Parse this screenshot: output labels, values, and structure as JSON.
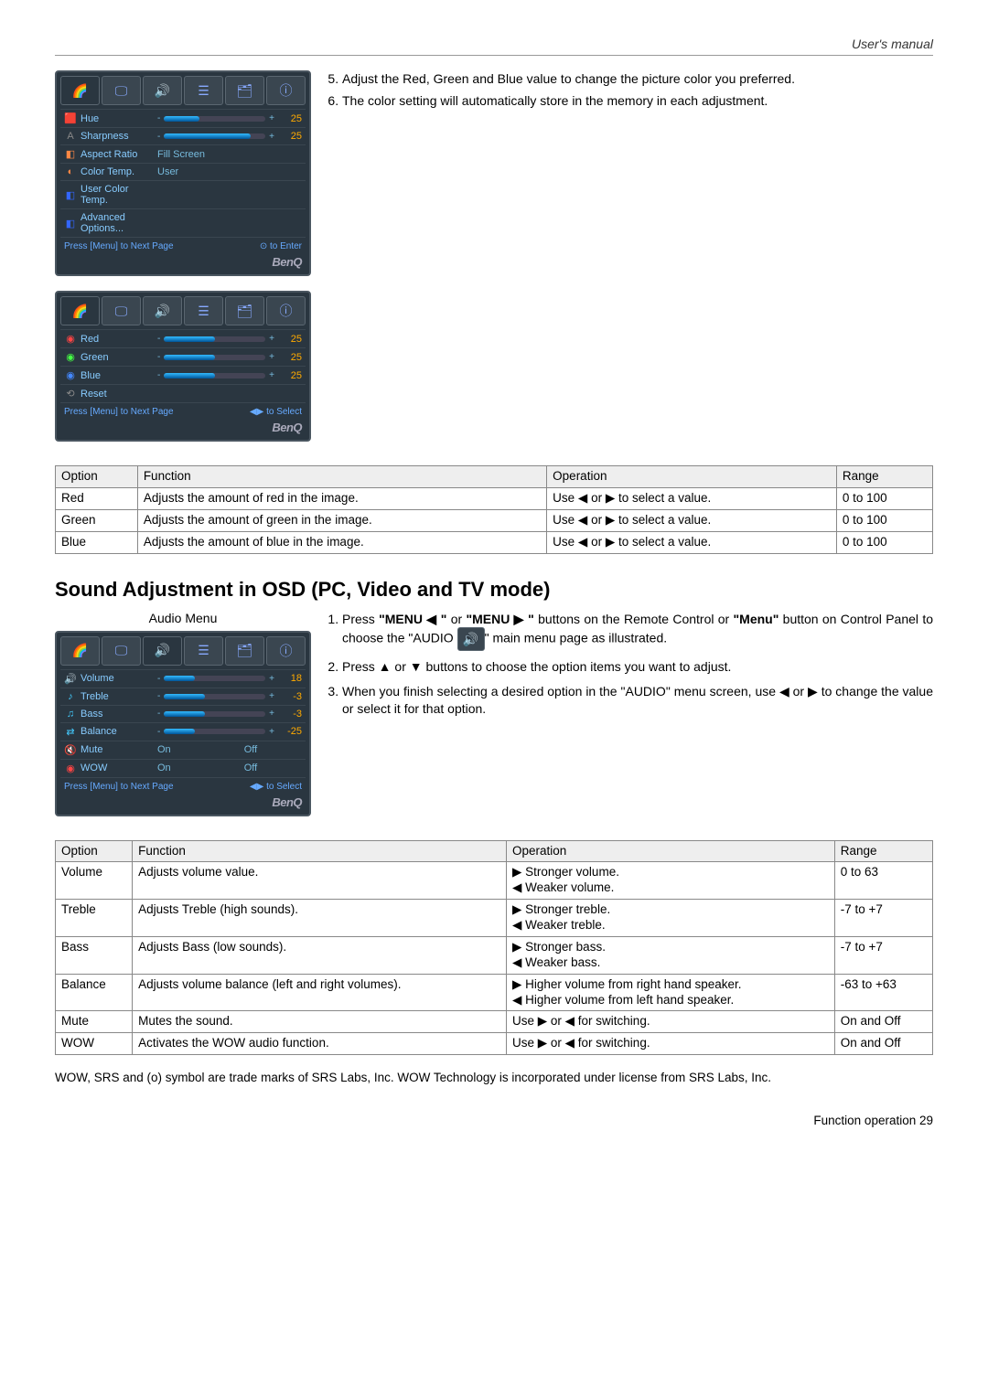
{
  "header": {
    "title": "User's manual"
  },
  "osd1": {
    "rows": [
      {
        "icon": "🟥",
        "label": "Hue",
        "num": "25",
        "fill": "35%",
        "color": "#f44"
      },
      {
        "icon": "A",
        "label": "Sharpness",
        "num": "25",
        "fill": "85%",
        "color": "#888"
      },
      {
        "icon": "◧",
        "label": "Aspect Ratio",
        "val": "Fill Screen",
        "color": "#f84"
      },
      {
        "icon": "◐",
        "label": "Color Temp.",
        "val": "User",
        "color": "#f84"
      },
      {
        "icon": "◧",
        "label": "User Color Temp.",
        "color": "#36f"
      },
      {
        "icon": "◧",
        "label": "Advanced Options...",
        "color": "#36f"
      }
    ],
    "footLeft": "Press [Menu] to Next Page",
    "footRight": "⊙ to Enter",
    "brand": "BenQ"
  },
  "osd2": {
    "rows": [
      {
        "icon": "◉",
        "label": "Red",
        "num": "25",
        "fill": "50%",
        "color": "#f44"
      },
      {
        "icon": "◉",
        "label": "Green",
        "num": "25",
        "fill": "50%",
        "color": "#4f4"
      },
      {
        "icon": "◉",
        "label": "Blue",
        "num": "25",
        "fill": "50%",
        "color": "#48f"
      },
      {
        "icon": "⟲",
        "label": "Reset",
        "color": "#888"
      }
    ],
    "footLeft": "Press [Menu] to Next Page",
    "footRight": "◀▶ to Select",
    "brand": "BenQ"
  },
  "topNotes": [
    {
      "num": "5.",
      "text": "Adjust the Red, Green and Blue value to change the picture color you preferred."
    },
    {
      "num": "6.",
      "text": "The color setting will automatically store in the memory in each adjustment."
    }
  ],
  "table1": {
    "headers": [
      "Option",
      "Function",
      "Operation",
      "Range"
    ],
    "rows": [
      [
        "Red",
        "Adjusts the amount of red in the image.",
        "Use ◀ or ▶ to select a value.",
        "0 to 100"
      ],
      [
        "Green",
        "Adjusts the amount of green in the image.",
        "Use ◀ or ▶ to select a value.",
        "0 to 100"
      ],
      [
        "Blue",
        "Adjusts the amount of blue in the image.",
        "Use ◀ or ▶ to select a value.",
        "0 to 100"
      ]
    ]
  },
  "soundHeading": "Sound Adjustment in OSD (PC, Video and TV mode)",
  "audioCaption": "Audio Menu",
  "osd3": {
    "rows": [
      {
        "icon": "🔊",
        "label": "Volume",
        "num": "18",
        "fill": "30%",
        "color": "#4cf"
      },
      {
        "icon": "♪",
        "label": "Treble",
        "num": "-3",
        "fill": "40%",
        "color": "#4cf"
      },
      {
        "icon": "♫",
        "label": "Bass",
        "num": "-3",
        "fill": "40%",
        "color": "#4cf"
      },
      {
        "icon": "⇄",
        "label": "Balance",
        "num": "-25",
        "fill": "30%",
        "color": "#4cf"
      },
      {
        "icon": "🔇",
        "label": "Mute",
        "val": "On",
        "val2": "Off",
        "color": "#f44"
      },
      {
        "icon": "◉",
        "label": "WOW",
        "val": "On",
        "val2": "Off",
        "color": "#f44"
      }
    ],
    "footLeft": "Press [Menu] to Next Page",
    "footRight": "◀▶ to Select",
    "brand": "BenQ"
  },
  "audioNotes": {
    "note1a": "Press ",
    "menuL": "\"MENU ◀ \"",
    "note1b": " or ",
    "menuR": "\"MENU ▶ \"",
    "note1c": " buttons on the Remote Control or ",
    "menuBold": "\"Menu\"",
    "note1d": " button on Control Panel to choose the \"AUDIO ",
    "note1e": "\" main menu page as illustrated.",
    "note2": "Press ▲ or ▼ buttons to choose the option items you want to adjust.",
    "note3": "When you finish selecting a desired option in the \"AUDIO\" menu screen, use ◀ or ▶ to change the value or select it for that option."
  },
  "table2": {
    "headers": [
      "Option",
      "Function",
      "Operation",
      "Range"
    ],
    "rows": [
      [
        "Volume",
        "Adjusts volume value.",
        "▶ Stronger volume.\n◀ Weaker volume.",
        "0 to 63"
      ],
      [
        "Treble",
        "Adjusts Treble (high sounds).",
        "▶ Stronger treble.\n◀ Weaker treble.",
        "-7 to +7"
      ],
      [
        "Bass",
        "Adjusts Bass (low sounds).",
        "▶ Stronger bass.\n◀ Weaker bass.",
        "-7 to +7"
      ],
      [
        "Balance",
        "Adjusts volume balance (left and right volumes).",
        "▶ Higher volume from right hand speaker.\n◀ Higher volume from left hand speaker.",
        "-63 to +63"
      ],
      [
        "Mute",
        "Mutes the sound.",
        "Use ▶ or ◀ for switching.",
        "On and Off"
      ],
      [
        "WOW",
        "Activates the WOW audio function.",
        "Use ▶ or ◀ for switching.",
        "On and Off"
      ]
    ]
  },
  "footerNote": "WOW, SRS and (o) symbol are trade marks of SRS Labs, Inc. WOW Technology is incorporated under license from SRS Labs, Inc.",
  "pageFooter": "Function operation    29"
}
